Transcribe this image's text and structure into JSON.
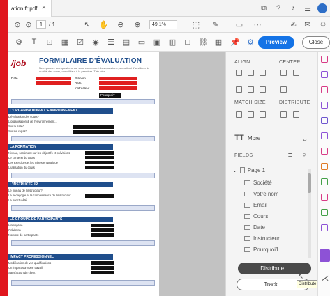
{
  "window": {
    "tab_title": "ation fr.pdf",
    "tab_close": "×"
  },
  "toolbar": {
    "page_current": "1",
    "page_total": "/ 1",
    "zoom": "49,1%",
    "preview_label": "Preview",
    "close_label": "Close"
  },
  "document": {
    "logo_text": "/job",
    "title": "FORMULAIRE D'ÉVALUATION",
    "subtitle": "Ne répondez aux questions qui vous concernent. Les questions permettent d'améliorer la qualité des cours, donc il faut à la première. Très bien.",
    "header_fields": [
      "Date",
      "Prénom",
      "Date",
      "Instructeur"
    ],
    "sections": [
      {
        "title": "L'ORGANISATION & L'ENVIRONNEMENT",
        "lines": [
          "L'évaluation des cours?",
          "L'organisation & de l'environnement...",
          "Sur la salle?",
          "Sur les repas?"
        ]
      },
      {
        "title": "LA FORMATION",
        "lines": [
          "Niveau, sentiment sur les objectifs et prévisions",
          "Le contenu du cours",
          "Les exercices et les mises en pratique",
          "L'utilisation du cours"
        ]
      },
      {
        "title": "L'INSTRUCTEUR",
        "lines": [
          "Le niveau de l'instructeur?",
          "La pédagogie et la connaissance de l'instructeur",
          "La ponctualité"
        ]
      },
      {
        "title": "LE GROUPE DE PARTICIPANTS",
        "lines": [
          "Homogène",
          "Cohésion",
          "Nombre de participants"
        ]
      },
      {
        "title": "IMPACT PROFESSIONNEL",
        "lines": [
          "Modification de vos qualifications",
          "Un impact sur votre travail",
          "Satisfaction du client"
        ]
      }
    ],
    "pourquoi": "Pourquoi?"
  },
  "right_panel": {
    "align_label": "ALIGN",
    "center_label": "CENTER",
    "match_size_label": "MATCH SIZE",
    "distribute_label": "DISTRIBUTE",
    "more_label": "More",
    "fields_label": "FIELDS",
    "page_node": "Page 1",
    "fields": [
      "Société",
      "Votre nom",
      "Email",
      "Cours",
      "Date",
      "Instructeur",
      "Pourquoi1"
    ],
    "distribute_btn": "Distribute...",
    "track_btn": "Track...",
    "tooltip": "Distribute the f"
  },
  "colors": {
    "accent": "#1473e6",
    "brand_red": "#e0161e",
    "section_blue": "#1f4e8c"
  }
}
